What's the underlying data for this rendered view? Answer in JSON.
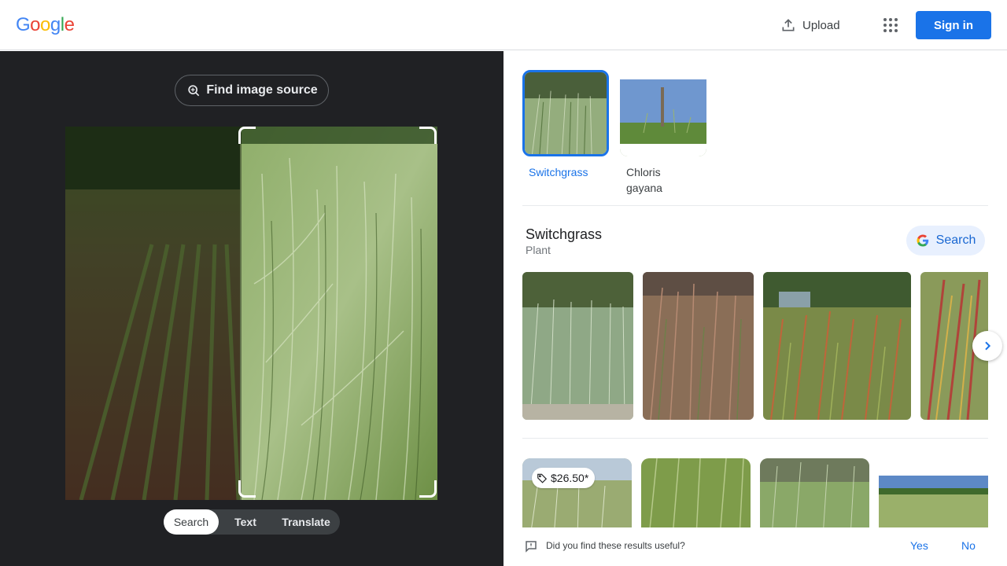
{
  "header": {
    "logo_letters": [
      "G",
      "o",
      "o",
      "g",
      "l",
      "e"
    ],
    "logo_colors": [
      "#4285F4",
      "#EA4335",
      "#FBBC05",
      "#4285F4",
      "#34A853",
      "#EA4335"
    ],
    "upload_label": "Upload",
    "signin_label": "Sign in",
    "icons": {
      "upload": "upload-icon",
      "apps": "apps-grid-icon"
    }
  },
  "left": {
    "find_source_label": "Find image source",
    "modes": [
      {
        "label": "Search",
        "active": true
      },
      {
        "label": "Text",
        "active": false
      },
      {
        "label": "Translate",
        "active": false
      }
    ]
  },
  "right": {
    "chips": [
      {
        "label": "Switchgrass",
        "active": true
      },
      {
        "label": "Chloris gayana",
        "active": false
      }
    ],
    "entity": {
      "title": "Switchgrass",
      "subtitle": "Plant",
      "search_label": "Search"
    },
    "result_price": "$26.50*",
    "feedback": {
      "question": "Did you find these results useful?",
      "yes": "Yes",
      "no": "No"
    }
  },
  "colors": {
    "accent": "#1a73e8",
    "dark_pane": "#202124",
    "chip_bg": "#e8f0fe"
  }
}
